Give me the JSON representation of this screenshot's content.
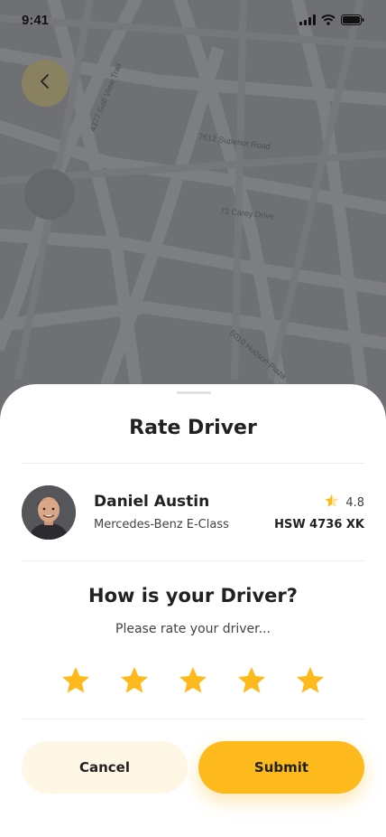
{
  "status_bar": {
    "time": "9:41",
    "icons": [
      "signal-icon",
      "wifi-icon",
      "battery-icon"
    ]
  },
  "map": {
    "streets": [
      "4377 Golf View Trail",
      "7612 Superior Road",
      "73 Carey Drive",
      "5010 Hudson Plaza"
    ]
  },
  "back_button": {
    "icon": "chevron-left-icon"
  },
  "sheet": {
    "title": "Rate Driver",
    "driver": {
      "name": "Daniel Austin",
      "car": "Mercedes-Benz E-Class",
      "rating": "4.8",
      "plate": "HSW 4736 XK"
    },
    "question": "How is your Driver?",
    "subtext": "Please rate your driver...",
    "stars": {
      "selected": 5,
      "total": 5
    },
    "cancel_label": "Cancel",
    "submit_label": "Submit"
  },
  "colors": {
    "accent": "#feba1d",
    "cancel_bg": "#fff7e6",
    "map_bg": "#6f7074"
  }
}
